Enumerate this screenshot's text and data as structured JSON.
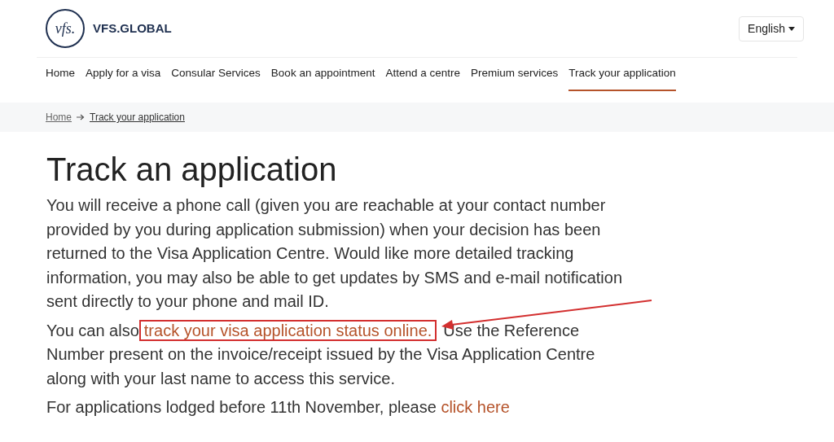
{
  "header": {
    "logo_mark": "vfs.",
    "logo_text": "VFS.GLOBAL",
    "language": "English"
  },
  "nav": [
    {
      "label": "Home",
      "selected": false
    },
    {
      "label": "Apply for a visa",
      "selected": false
    },
    {
      "label": "Consular Services",
      "selected": false
    },
    {
      "label": "Book an appointment",
      "selected": false
    },
    {
      "label": "Attend a centre",
      "selected": false
    },
    {
      "label": "Premium services",
      "selected": false
    },
    {
      "label": "Track your application",
      "selected": true
    }
  ],
  "breadcrumb": [
    "Home",
    "Track your application"
  ],
  "title": "Track an application",
  "intro": "You will receive a phone call (given you are reachable at your contact number provided by you during application submission) when your decision has been returned to the Visa Application Centre. Would like more detailed tracking information, you may also be able to get updates by SMS and e-mail notification sent directly to your phone and mail ID.",
  "track": {
    "before": "You can also",
    "link": "track your visa application status online.",
    "after": "Use the Reference Number present on the invoice/receipt issued by the Visa Application Centre along with your last name to access this service.",
    "highlighted": true
  },
  "older": {
    "text": "For applications lodged before 11th November, please",
    "link": "click here"
  }
}
